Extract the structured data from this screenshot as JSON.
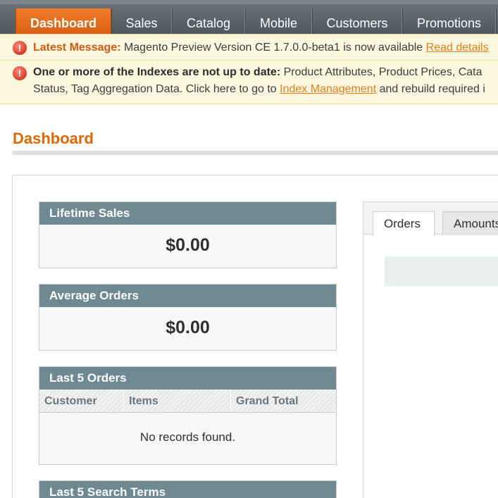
{
  "nav": {
    "items": [
      "Dashboard",
      "Sales",
      "Catalog",
      "Mobile",
      "Customers",
      "Promotions"
    ],
    "active": "Dashboard"
  },
  "messages": {
    "latest": {
      "label": "Latest Message:",
      "text": "Magento Preview Version CE 1.7.0.0-beta1 is now available",
      "link": "Read details"
    },
    "indexes": {
      "label": "One or more of the Indexes are not up to date:",
      "text1": "Product Attributes, Product Prices, Cata",
      "text2a": "Status, Tag Aggregation Data. Click here to go to",
      "link": "Index Management",
      "text2b": "and rebuild required i"
    }
  },
  "page": {
    "title": "Dashboard"
  },
  "panels": {
    "lifetime_sales": {
      "title": "Lifetime Sales",
      "value": "$0.00"
    },
    "average_orders": {
      "title": "Average Orders",
      "value": "$0.00"
    },
    "last_orders": {
      "title": "Last 5 Orders",
      "columns": [
        "Customer",
        "Items",
        "Grand Total"
      ],
      "empty": "No records found."
    },
    "last_search_terms": {
      "title": "Last 5 Search Terms"
    }
  },
  "tabs": {
    "items": [
      "Orders",
      "Amounts"
    ],
    "active": "Orders"
  },
  "colors": {
    "nav_active": "#e26703",
    "panel_header": "#6f8992",
    "title": "#e26703",
    "message_bg": "#fcf7de"
  }
}
